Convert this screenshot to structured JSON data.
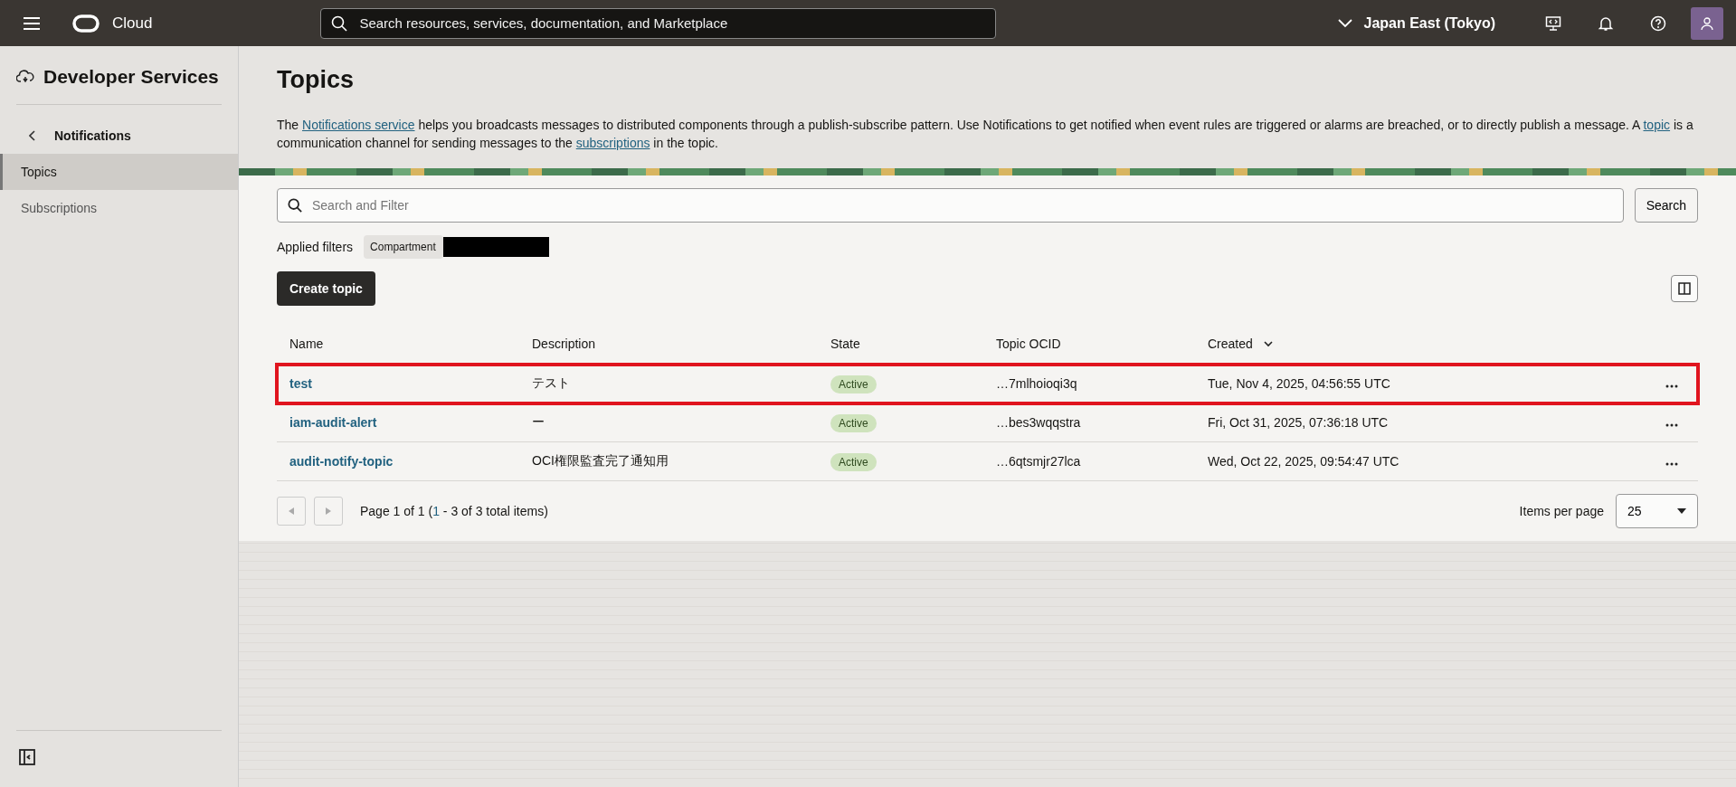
{
  "header": {
    "brand": "Cloud",
    "search": {
      "placeholder": "Search resources, services, documentation, and Marketplace"
    },
    "region": "Japan East (Tokyo)"
  },
  "sidebar": {
    "title": "Developer Services",
    "back": "Notifications",
    "items": [
      {
        "label": "Topics",
        "selected": true
      },
      {
        "label": "Subscriptions",
        "selected": false
      }
    ]
  },
  "page": {
    "title": "Topics",
    "description": [
      {
        "text": "The ",
        "link": false
      },
      {
        "text": "Notifications service",
        "link": true
      },
      {
        "text": " helps you broadcasts messages to distributed components through a publish-subscribe pattern. Use Notifications to get notified when event rules are triggered or alarms are breached, or to directly publish a message. A ",
        "link": false
      },
      {
        "text": "topic",
        "link": true
      },
      {
        "text": " is a communication channel for sending messages to the ",
        "link": false
      },
      {
        "text": "subscriptions",
        "link": true
      },
      {
        "text": " in the topic.",
        "link": false
      }
    ]
  },
  "filter": {
    "placeholder": "Search and Filter",
    "search_button": "Search",
    "applied_label": "Applied filters",
    "chips": [
      "Compartment"
    ]
  },
  "create_button": "Create topic",
  "table": {
    "columns": [
      "Name",
      "Description",
      "State",
      "Topic OCID",
      "Created"
    ],
    "rows": [
      {
        "name": "test",
        "description": "テスト",
        "state": "Active",
        "ocid": "…7mlhoioqi3q",
        "created": "Tue, Nov 4, 2025, 04:56:55 UTC",
        "highlighted": true
      },
      {
        "name": "iam-audit-alert",
        "description": "ー",
        "state": "Active",
        "ocid": "…bes3wqqstra",
        "created": "Fri, Oct 31, 2025, 07:36:18 UTC",
        "highlighted": false
      },
      {
        "name": "audit-notify-topic",
        "description": "OCI権限監査完了通知用",
        "state": "Active",
        "ocid": "…6qtsmjr27lca",
        "created": "Wed, Oct 22, 2025, 09:54:47 UTC",
        "highlighted": false
      }
    ]
  },
  "pagination": {
    "prefix": "Page 1 of 1 (",
    "link": "1",
    "suffix": " - 3 of 3 total items)",
    "per_page_label": "Items per page",
    "per_page": "25"
  }
}
